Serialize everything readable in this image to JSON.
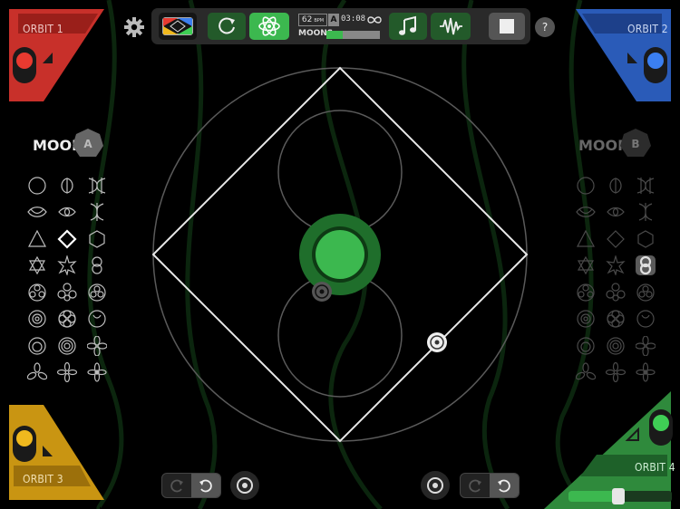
{
  "orbits": {
    "orbit1": {
      "label": "ORBIT 1",
      "color": "#c8302a"
    },
    "orbit2": {
      "label": "ORBIT 2",
      "color": "#2a5bb8"
    },
    "orbit3": {
      "label": "ORBIT 3",
      "color": "#c99512"
    },
    "orbit4": {
      "label": "ORBIT 4",
      "color": "#2f8a3c",
      "slider_value": 0.48
    }
  },
  "toolbar": {
    "bpm_value": "62",
    "bpm_unit": "BPM",
    "moon_letter": "A",
    "time": "03:08",
    "moons_label": "MOONS",
    "moons_fill": 0.3,
    "help_label": "?"
  },
  "moon_a": {
    "title": "MOON",
    "badge": "A"
  },
  "moon_b": {
    "title": "MOON",
    "badge": "B"
  },
  "accent_green": "#3cb84f",
  "icons": [
    "gear-icon",
    "palette-icon",
    "loop-icon",
    "atom-icon",
    "infinity-icon",
    "music-note-icon",
    "waveform-icon",
    "stop-icon",
    "help-icon",
    "rotate-cw-icon",
    "rotate-ccw-icon",
    "target-icon"
  ]
}
